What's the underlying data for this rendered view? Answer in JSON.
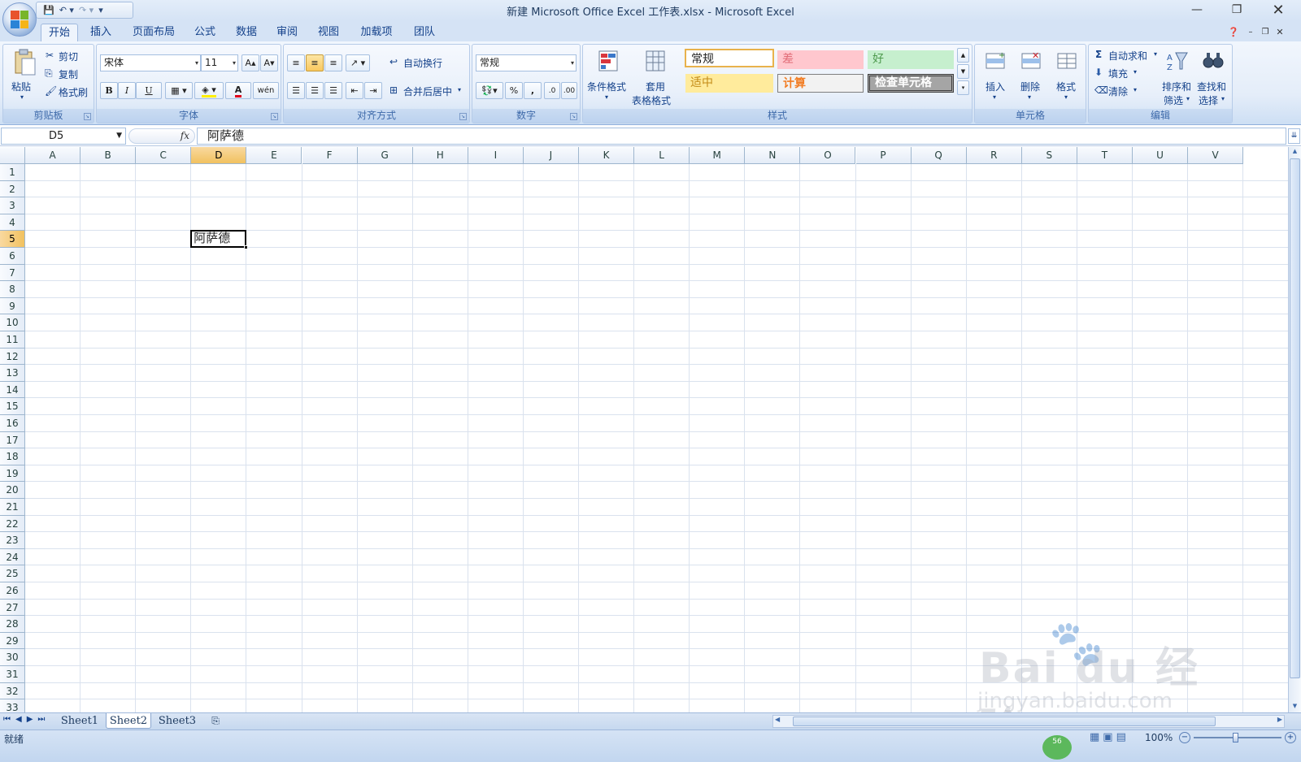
{
  "window": {
    "title": "新建 Microsoft Office Excel 工作表.xlsx - Microsoft Excel"
  },
  "tabs": [
    {
      "label": "开始",
      "active": true
    },
    {
      "label": "插入"
    },
    {
      "label": "页面布局"
    },
    {
      "label": "公式"
    },
    {
      "label": "数据"
    },
    {
      "label": "审阅"
    },
    {
      "label": "视图"
    },
    {
      "label": "加载项"
    },
    {
      "label": "团队"
    }
  ],
  "ribbon": {
    "clipboard": {
      "group": "剪贴板",
      "paste": "粘贴",
      "cut": "剪切",
      "copy": "复制",
      "format_painter": "格式刷"
    },
    "font": {
      "group": "字体",
      "name": "宋体",
      "size": "11",
      "bold": "B",
      "italic": "I",
      "underline": "U",
      "font_color_glyph": "A",
      "phonetic": "wén"
    },
    "alignment": {
      "group": "对齐方式",
      "wrap": "自动换行",
      "merge": "合并后居中"
    },
    "number": {
      "group": "数字",
      "format": "常规",
      "percent": "%",
      "comma": ","
    },
    "styles": {
      "group": "样式",
      "conditional": "条件格式",
      "table_1": "套用",
      "table_2": "表格格式",
      "normal": "常规",
      "bad": "差",
      "good": "好",
      "neutral": "适中",
      "calc": "计算",
      "check": "检查单元格"
    },
    "cells": {
      "group": "单元格",
      "insert": "插入",
      "delete": "删除",
      "format": "格式"
    },
    "editing": {
      "group": "编辑",
      "autosum": "自动求和",
      "fill": "填充",
      "clear": "清除",
      "sort_1": "排序和",
      "sort_2": "筛选",
      "find_1": "查找和",
      "find_2": "选择"
    }
  },
  "formula_bar": {
    "name_box": "D5",
    "fx": "fx",
    "content": "阿萨德"
  },
  "grid": {
    "columns": [
      "A",
      "B",
      "C",
      "D",
      "E",
      "F",
      "G",
      "H",
      "I",
      "J",
      "K",
      "L",
      "M",
      "N",
      "O",
      "P",
      "Q",
      "R",
      "S",
      "T",
      "U",
      "V"
    ],
    "selected_column": "D",
    "rows": [
      "1",
      "2",
      "3",
      "4",
      "5",
      "6",
      "7",
      "8",
      "9",
      "10",
      "11",
      "12",
      "13",
      "14",
      "15",
      "16",
      "17",
      "18",
      "19",
      "20",
      "21",
      "22",
      "23",
      "24",
      "25",
      "26",
      "27",
      "28",
      "29",
      "30",
      "31",
      "32",
      "33"
    ],
    "selected_row": "5",
    "active_cell": {
      "ref": "D5",
      "value": "阿萨德"
    }
  },
  "sheets": [
    {
      "label": "Sheet1"
    },
    {
      "label": "Sheet2",
      "active": true
    },
    {
      "label": "Sheet3"
    }
  ],
  "status": {
    "ready": "就绪",
    "zoom": "100%",
    "badge": "56"
  },
  "watermark": {
    "brand": "Bai du 经验",
    "url": "jingyan.baidu.com"
  }
}
